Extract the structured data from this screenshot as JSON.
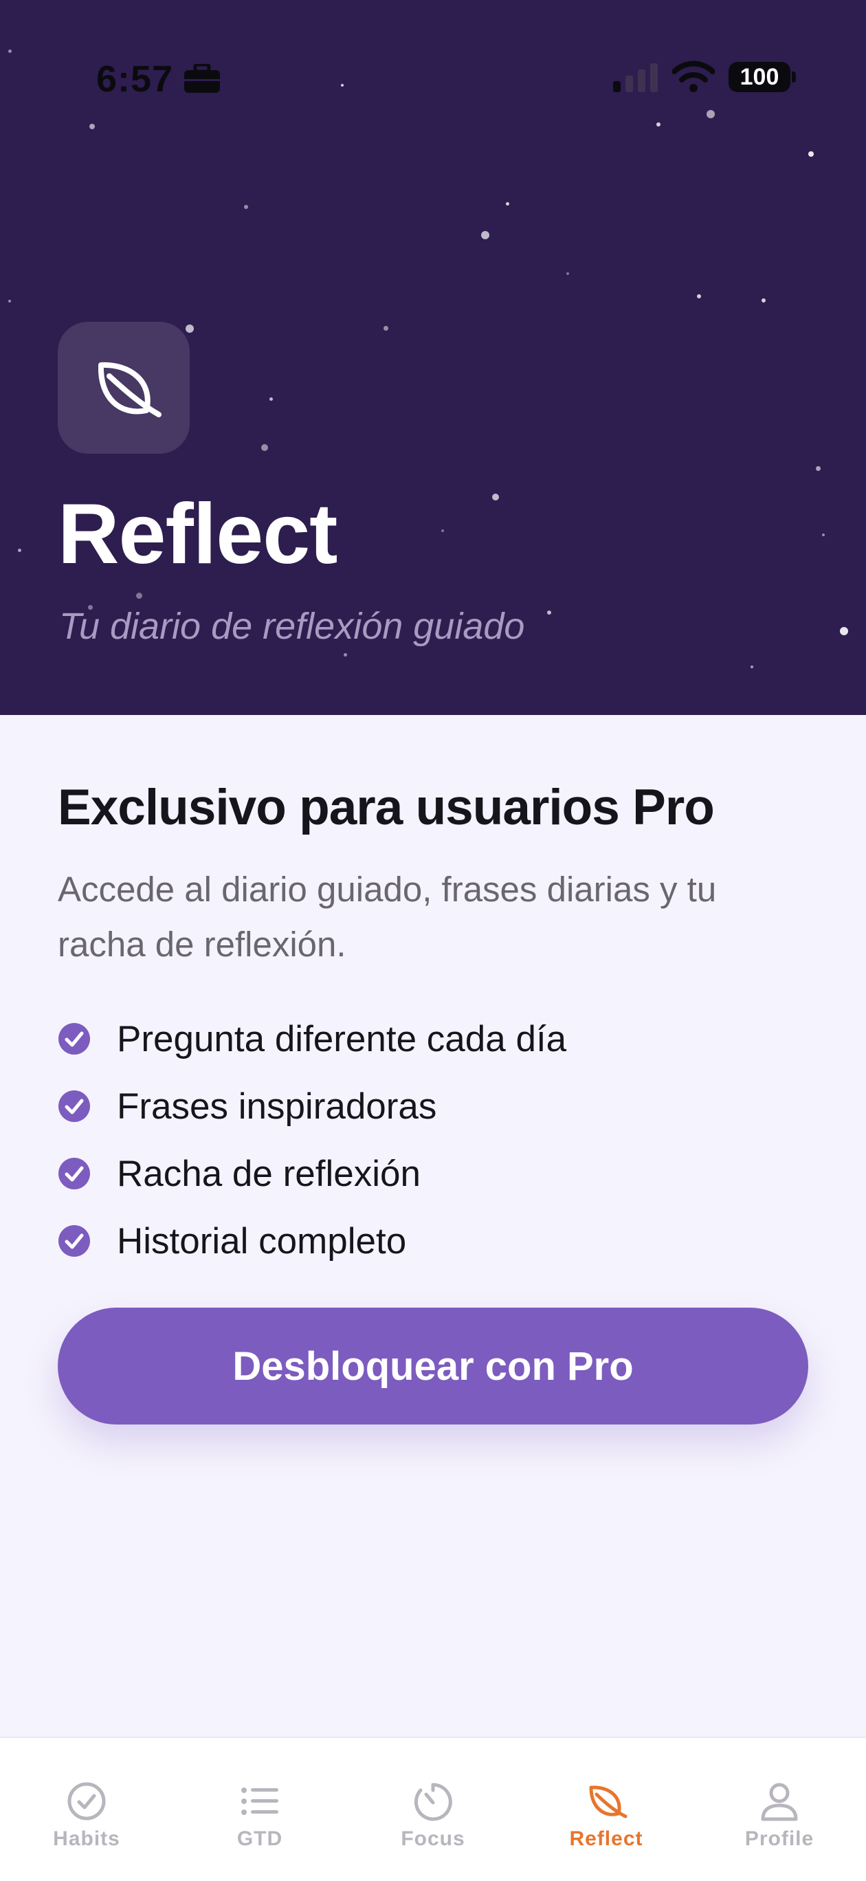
{
  "status_bar": {
    "time": "6:57",
    "battery": "100"
  },
  "hero": {
    "icon": "leaf-icon",
    "title": "Reflect",
    "subtitle": "Tu diario de reflexión guiado"
  },
  "paywall": {
    "heading": "Exclusivo para usuarios Pro",
    "description": "Accede al diario guiado, frases diarias y tu racha de reflexión.",
    "features": [
      "Pregunta diferente cada día",
      "Frases inspiradoras",
      "Racha de reflexión",
      "Historial completo"
    ],
    "cta_label": "Desbloquear con Pro"
  },
  "tab_bar": {
    "tabs": [
      {
        "label": "Habits",
        "icon": "check-circle-icon"
      },
      {
        "label": "GTD",
        "icon": "list-icon"
      },
      {
        "label": "Focus",
        "icon": "timer-icon"
      },
      {
        "label": "Reflect",
        "icon": "leaf-icon",
        "active": true
      },
      {
        "label": "Profile",
        "icon": "person-icon"
      }
    ]
  },
  "colors": {
    "hero_background": "#2e1d4f",
    "accent_purple": "#7c5cbf",
    "active_tab": "#e8752c",
    "inactive_tab": "#b8b5bd",
    "page_background": "#f5f3fd"
  }
}
